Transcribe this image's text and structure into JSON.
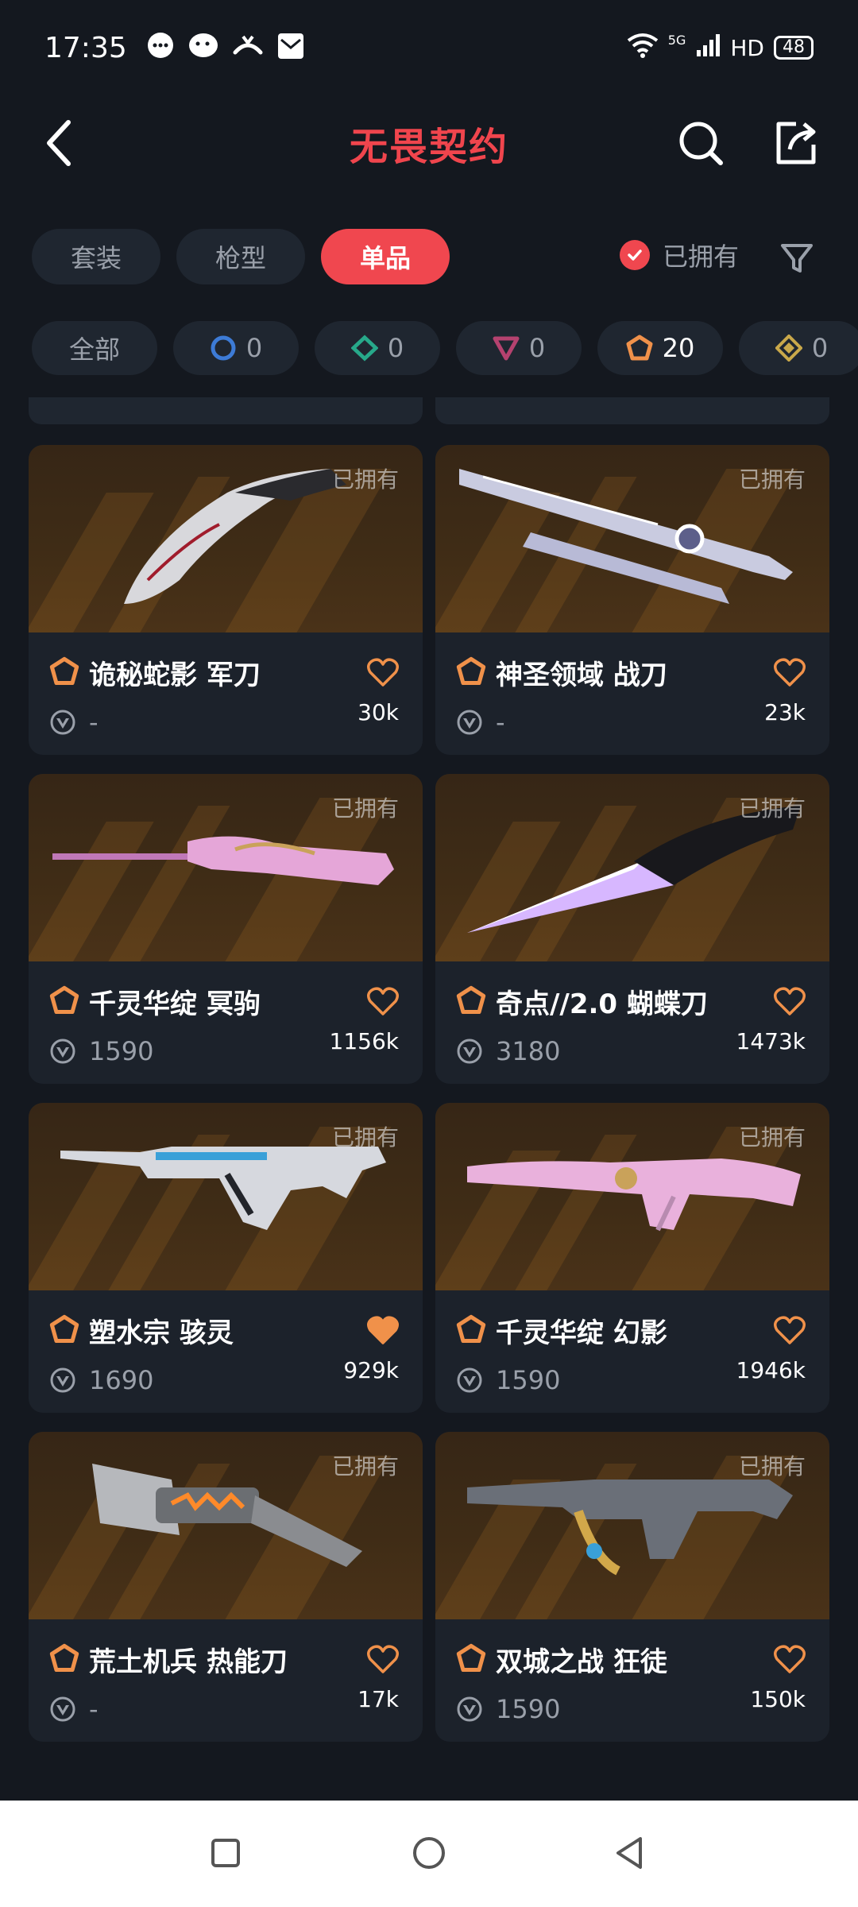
{
  "status_bar": {
    "time": "17:35",
    "network": "5G",
    "hd": "HD",
    "battery": "48"
  },
  "header": {
    "title": "无畏契约"
  },
  "tabs": [
    {
      "label": "套装"
    },
    {
      "label": "枪型"
    },
    {
      "label": "单品",
      "active": true
    }
  ],
  "owned_filter": {
    "label": "已拥有",
    "checked": true
  },
  "rarity_chips": [
    {
      "label": "全部",
      "type": "all"
    },
    {
      "count": "0",
      "type": "select",
      "color": "#3d7bd6"
    },
    {
      "count": "0",
      "type": "deluxe",
      "color": "#27a98a"
    },
    {
      "count": "0",
      "type": "premium",
      "color": "#b5426f"
    },
    {
      "count": "20",
      "type": "exclusive",
      "color": "#f0914a",
      "selected": true
    },
    {
      "count": "0",
      "type": "ultra",
      "color": "#c9a84a"
    }
  ],
  "items": [
    {
      "name": "诡秘蛇影 军刀",
      "price": "-",
      "likes": "30k",
      "owned_label": "已拥有",
      "favorited": false,
      "weapon": "karambit-knife"
    },
    {
      "name": "神圣领域 战刀",
      "price": "-",
      "likes": "23k",
      "owned_label": "已拥有",
      "favorited": false,
      "weapon": "dual-blades"
    },
    {
      "name": "千灵华绽 冥驹",
      "price": "1590",
      "likes": "1156k",
      "owned_label": "已拥有",
      "favorited": false,
      "weapon": "sniper-rifle"
    },
    {
      "name": "奇点//2.0 蝴蝶刀",
      "price": "3180",
      "likes": "1473k",
      "owned_label": "已拥有",
      "favorited": false,
      "weapon": "crystal-knife"
    },
    {
      "name": "塑水宗 骇灵",
      "price": "1690",
      "likes": "929k",
      "owned_label": "已拥有",
      "favorited": true,
      "weapon": "smg"
    },
    {
      "name": "千灵华绽 幻影",
      "price": "1590",
      "likes": "1946k",
      "owned_label": "已拥有",
      "favorited": false,
      "weapon": "rifle-pink"
    },
    {
      "name": "荒土机兵 热能刀",
      "price": "-",
      "likes": "17k",
      "owned_label": "已拥有",
      "favorited": false,
      "weapon": "cleaver"
    },
    {
      "name": "双城之战 狂徒",
      "price": "1590",
      "likes": "150k",
      "owned_label": "已拥有",
      "favorited": false,
      "weapon": "assault-rifle"
    }
  ],
  "colors": {
    "accent": "#f0474f",
    "tier": "#f0914a",
    "heart": "#f0914a",
    "background": "#14181f",
    "card": "#1c222b"
  }
}
